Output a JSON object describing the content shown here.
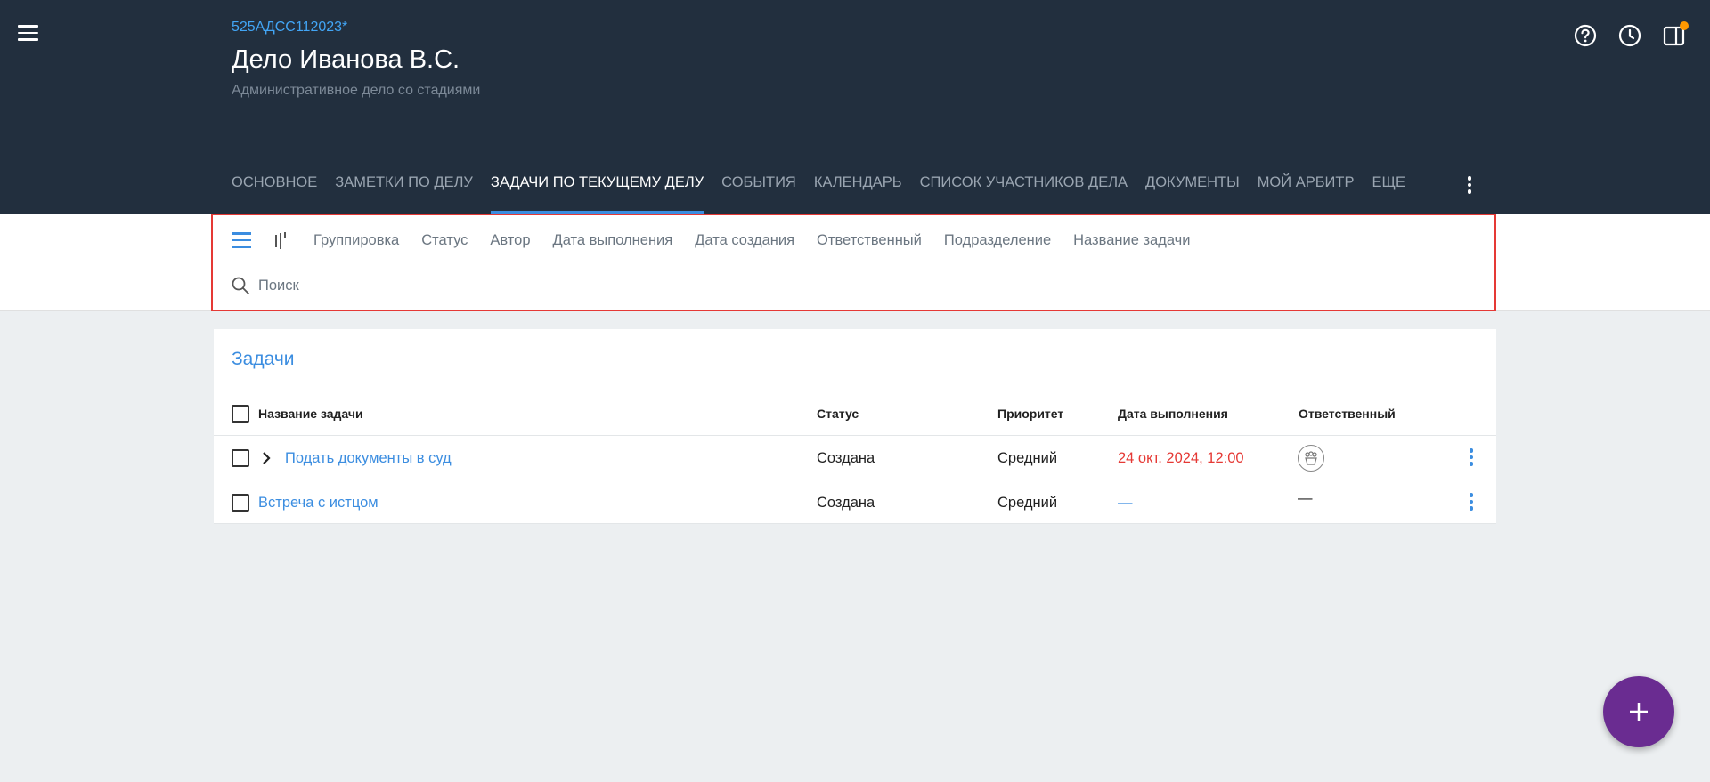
{
  "header": {
    "case_number": "525АДСС112023*",
    "case_title": "Дело Иванова В.С.",
    "case_subtitle": "Административное дело со стадиями"
  },
  "icons": {
    "menu": "menu-icon",
    "help": "help-circle-icon",
    "history": "clock-icon",
    "panel": "side-panel-icon",
    "notification_color": "#ff9800"
  },
  "tabs": [
    {
      "label": "ОСНОВНОЕ",
      "active": false
    },
    {
      "label": "ЗАМЕТКИ ПО ДЕЛУ",
      "active": false
    },
    {
      "label": "ЗАДАЧИ ПО ТЕКУЩЕМУ ДЕЛУ",
      "active": true
    },
    {
      "label": "СОБЫТИЯ",
      "active": false
    },
    {
      "label": "КАЛЕНДАРЬ",
      "active": false
    },
    {
      "label": "СПИСОК УЧАСТНИКОВ ДЕЛА",
      "active": false
    },
    {
      "label": "ДОКУМЕНТЫ",
      "active": false
    },
    {
      "label": "МОЙ АРБИТР",
      "active": false
    },
    {
      "label": "ЕЩЕ",
      "active": false
    }
  ],
  "filters": {
    "chips": [
      "Группировка",
      "Статус",
      "Автор",
      "Дата выполнения",
      "Дата создания",
      "Ответственный",
      "Подразделение",
      "Название задачи"
    ],
    "search_placeholder": "Поиск"
  },
  "tasks": {
    "title": "Задачи",
    "columns": {
      "name": "Название задачи",
      "status": "Статус",
      "priority": "Приоритет",
      "due_date": "Дата выполнения",
      "assignee": "Ответственный"
    },
    "rows": [
      {
        "name": "Подать документы в суд",
        "status": "Создана",
        "priority": "Средний",
        "due_date": "24 окт. 2024, 12:00",
        "assignee": "group-avatar-icon",
        "expandable": true,
        "overdue": true
      },
      {
        "name": "Встреча с истцом",
        "status": "Создана",
        "priority": "Средний",
        "due_date": "—",
        "assignee": "—",
        "expandable": false,
        "overdue": false
      }
    ]
  },
  "colors": {
    "header_bg": "#222f3e",
    "accent": "#3b8de0",
    "overdue": "#e53935",
    "fab": "#6a2c91",
    "highlight_frame": "#e53935"
  }
}
